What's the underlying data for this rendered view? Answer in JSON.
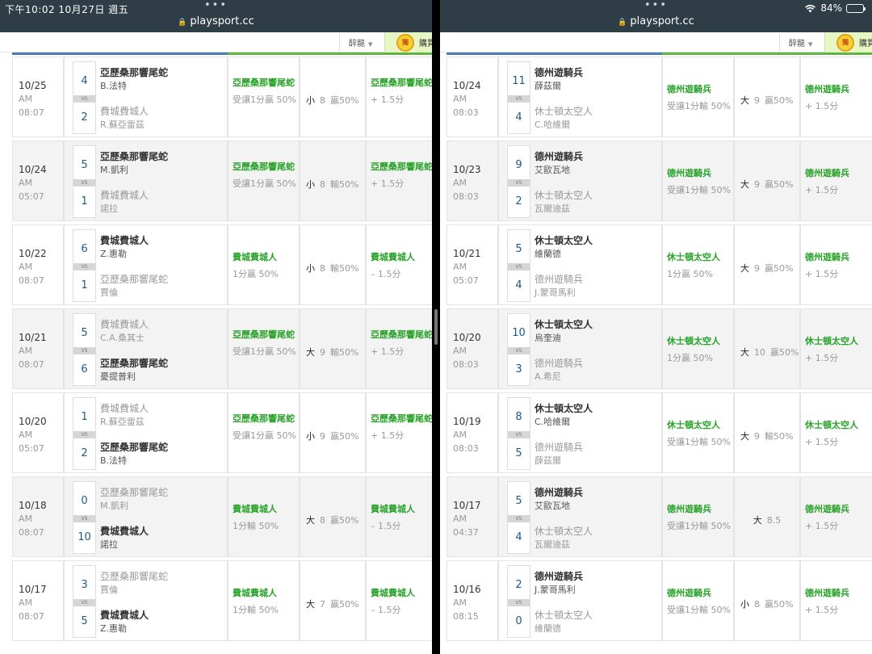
{
  "status": {
    "time_date": "下午10:02   10月27日 週五",
    "battery": "84%",
    "battery_level": 0.84
  },
  "left": {
    "url": "playsport.cc",
    "lang": "醉龍",
    "promo": "購買",
    "badge": "獨",
    "rows": [
      {
        "date": "10/25",
        "ampm": "AM",
        "time": "08:07",
        "s1": "4",
        "s2": "2",
        "t1": "亞歷桑那響尾蛇",
        "p1": "B.法特",
        "t2": "費城費城人",
        "p2": "R.蘇亞雷茲",
        "win": 1,
        "pick": "亞歷桑那響尾蛇",
        "spread": "受讓1分贏 50%",
        "ou": "小",
        "ou_num": "8",
        "ou_res": "贏50%",
        "pick2": "亞歷桑那響尾蛇",
        "spread2": "+ 1.5分"
      },
      {
        "date": "10/24",
        "ampm": "AM",
        "time": "05:07",
        "s1": "5",
        "s2": "1",
        "t1": "亞歷桑那響尾蛇",
        "p1": "M.凱利",
        "t2": "費城費城人",
        "p2": "諾拉",
        "win": 1,
        "pick": "亞歷桑那響尾蛇",
        "spread": "受讓1分贏 50%",
        "ou": "小",
        "ou_num": "8",
        "ou_res": "輸50%",
        "pick2": "亞歷桑那響尾蛇",
        "spread2": "+ 1.5分"
      },
      {
        "date": "10/22",
        "ampm": "AM",
        "time": "08:07",
        "s1": "6",
        "s2": "1",
        "t1": "費城費城人",
        "p1": "Z.惠勒",
        "t2": "亞歷桑那響尾蛇",
        "p2": "賈倫",
        "win": 1,
        "pick": "費城費城人",
        "spread": "1分贏 50%",
        "ou": "小",
        "ou_num": "8",
        "ou_res": "輸50%",
        "pick2": "費城費城人",
        "spread2": "– 1.5分"
      },
      {
        "date": "10/21",
        "ampm": "AM",
        "time": "08:07",
        "s1": "5",
        "s2": "6",
        "t1": "費城費城人",
        "p1": "C.A.桑其士",
        "t2": "亞歷桑那響尾蛇",
        "p2": "憂提普利",
        "win": 2,
        "pick": "亞歷桑那響尾蛇",
        "spread": "受讓1分贏 50%",
        "ou": "大",
        "ou_num": "9",
        "ou_res": "輸50%",
        "pick2": "亞歷桑那響尾蛇",
        "spread2": "+ 1.5分"
      },
      {
        "date": "10/20",
        "ampm": "AM",
        "time": "05:07",
        "s1": "1",
        "s2": "2",
        "t1": "費城費城人",
        "p1": "R.蘇亞雷茲",
        "t2": "亞歷桑那響尾蛇",
        "p2": "B.法特",
        "win": 2,
        "pick": "亞歷桑那響尾蛇",
        "spread": "受讓1分贏 50%",
        "ou": "小",
        "ou_num": "9",
        "ou_res": "贏50%",
        "pick2": "亞歷桑那響尾蛇",
        "spread2": "+ 1.5分"
      },
      {
        "date": "10/18",
        "ampm": "AM",
        "time": "08:07",
        "s1": "0",
        "s2": "10",
        "t1": "亞歷桑那響尾蛇",
        "p1": "M.凱利",
        "t2": "費城費城人",
        "p2": "諾拉",
        "win": 2,
        "pick": "費城費城人",
        "spread": "1分輸 50%",
        "ou": "大",
        "ou_num": "8",
        "ou_res": "贏50%",
        "pick2": "費城費城人",
        "spread2": "– 1.5分"
      },
      {
        "date": "10/17",
        "ampm": "AM",
        "time": "08:07",
        "s1": "3",
        "s2": "5",
        "t1": "亞歷桑那響尾蛇",
        "p1": "賈倫",
        "t2": "費城費城人",
        "p2": "Z.惠勒",
        "win": 2,
        "pick": "費城費城人",
        "spread": "1分輸 50%",
        "ou": "大",
        "ou_num": "7",
        "ou_res": "贏50%",
        "pick2": "費城費城人",
        "spread2": "– 1.5分"
      }
    ]
  },
  "right": {
    "url": "playsport.cc",
    "lang": "醉龍",
    "promo": "購買",
    "badge": "獨",
    "rows": [
      {
        "date": "10/24",
        "ampm": "AM",
        "time": "08:03",
        "s1": "11",
        "s2": "4",
        "t1": "德州遊騎兵",
        "p1": "薛茲爾",
        "t2": "休士頓太空人",
        "p2": "C.哈維爾",
        "win": 1,
        "pick": "德州遊騎兵",
        "spread": "受讓1分輸 50%",
        "ou": "大",
        "ou_num": "9",
        "ou_res": "贏50%",
        "pick2": "德州遊騎兵",
        "spread2": "+ 1.5分"
      },
      {
        "date": "10/23",
        "ampm": "AM",
        "time": "08:03",
        "s1": "9",
        "s2": "2",
        "t1": "德州遊騎兵",
        "p1": "艾歐瓦地",
        "t2": "休士頓太空人",
        "p2": "瓦爾迪茲",
        "win": 1,
        "pick": "德州遊騎兵",
        "spread": "受讓1分輸 50%",
        "ou": "大",
        "ou_num": "9",
        "ou_res": "贏50%",
        "pick2": "德州遊騎兵",
        "spread2": "+ 1.5分"
      },
      {
        "date": "10/21",
        "ampm": "AM",
        "time": "05:07",
        "s1": "5",
        "s2": "4",
        "t1": "休士頓太空人",
        "p1": "維蘭德",
        "t2": "德州遊騎兵",
        "p2": "J.蒙哥馬利",
        "win": 1,
        "pick": "休士頓太空人",
        "spread": "1分贏 50%",
        "ou": "大",
        "ou_num": "9",
        "ou_res": "贏50%",
        "pick2": "德州遊騎兵",
        "spread2": "+ 1.5分"
      },
      {
        "date": "10/20",
        "ampm": "AM",
        "time": "08:03",
        "s1": "10",
        "s2": "3",
        "t1": "休士頓太空人",
        "p1": "烏奎迪",
        "t2": "德州遊騎兵",
        "p2": "A.希尼",
        "win": 1,
        "pick": "休士頓太空人",
        "spread": "1分贏 50%",
        "ou": "大",
        "ou_num": "10",
        "ou_res": "贏50%",
        "pick2": "休士頓太空人",
        "spread2": "+ 1.5分"
      },
      {
        "date": "10/19",
        "ampm": "AM",
        "time": "08:03",
        "s1": "8",
        "s2": "5",
        "t1": "休士頓太空人",
        "p1": "C.哈維爾",
        "t2": "德州遊騎兵",
        "p2": "薛茲爾",
        "win": 1,
        "pick": "休士頓太空人",
        "spread": "受讓1分輸 50%",
        "ou": "大",
        "ou_num": "9",
        "ou_res": "輸50%",
        "pick2": "休士頓太空人",
        "spread2": "+ 1.5分"
      },
      {
        "date": "10/17",
        "ampm": "AM",
        "time": "04:37",
        "s1": "5",
        "s2": "4",
        "t1": "德州遊騎兵",
        "p1": "艾歐瓦地",
        "t2": "休士頓太空人",
        "p2": "瓦爾迪茲",
        "win": 1,
        "pick": "德州遊騎兵",
        "spread": "受讓1分輸 50%",
        "ou": "大",
        "ou_num": "8.5",
        "ou_res": "",
        "pick2": "德州遊騎兵",
        "spread2": "+ 1.5分"
      },
      {
        "date": "10/16",
        "ampm": "AM",
        "time": "08:15",
        "s1": "2",
        "s2": "0",
        "t1": "德州遊騎兵",
        "p1": "J.蒙哥馬利",
        "t2": "休士頓太空人",
        "p2": "維蘭德",
        "win": 1,
        "pick": "德州遊騎兵",
        "spread": "受讓1分輸 50%",
        "ou": "小",
        "ou_num": "8",
        "ou_res": "贏50%",
        "pick2": "德州遊騎兵",
        "spread2": "+ 1.5分"
      }
    ]
  },
  "colors": {
    "pick": "#27a327",
    "score": "#1c5a8e",
    "chrome": "#2f3d46",
    "accent_blue": "#4b7db5",
    "accent_green": "#5fb542"
  }
}
